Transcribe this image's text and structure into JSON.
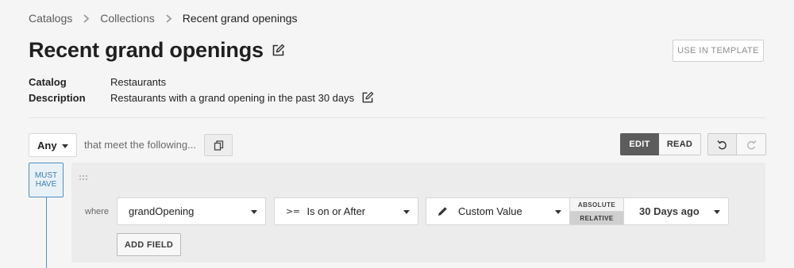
{
  "breadcrumb": {
    "items": [
      "Catalogs",
      "Collections",
      "Recent grand openings"
    ]
  },
  "header": {
    "title": "Recent grand openings",
    "use_template_label": "USE IN TEMPLATE"
  },
  "meta": {
    "catalog_label": "Catalog",
    "catalog_value": "Restaurants",
    "description_label": "Description",
    "description_value": "Restaurants with a grand opening in the past 30 days"
  },
  "filter": {
    "match_mode": "Any",
    "meet_text": "that meet the following...",
    "view_modes": [
      "EDIT",
      "READ"
    ],
    "active_view_mode": "EDIT"
  },
  "rule_group": {
    "badge_line1": "MUST",
    "badge_line2": "HAVE",
    "where_label": "where",
    "field": "grandOpening",
    "operator_icon": ">=",
    "operator": "Is on or After",
    "value_type": "Custom Value",
    "date_modes": [
      "ABSOLUTE",
      "RELATIVE"
    ],
    "active_date_mode": "RELATIVE",
    "relative_value": "30 Days ago",
    "add_field_label": "ADD FIELD"
  },
  "colors": {
    "accent_blue": "#4f8fc0",
    "active_toggle": "#5c5c5c",
    "background": "#f5f5f5"
  },
  "icons": {
    "breadcrumb_separator": "chevron-right-icon",
    "title_edit": "edit-icon",
    "description_edit": "edit-icon",
    "copy": "copy-icon",
    "undo": "undo-icon",
    "redo": "redo-icon",
    "drag": "drag-handle-icon",
    "value_type": "pencil-icon"
  }
}
